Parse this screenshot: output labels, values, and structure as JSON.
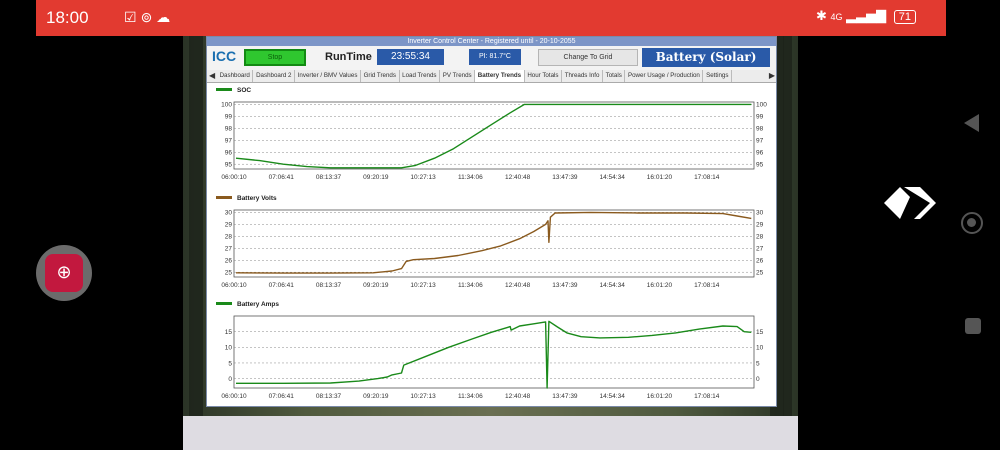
{
  "status_bar": {
    "time": "18:00",
    "network": "4G",
    "battery": "71"
  },
  "app": {
    "window_title": "Inverter Control Center - Registered until - 20-10-2055",
    "logo": "ICC",
    "stop_label": "Stop",
    "runtime_label": "RunTime",
    "runtime_value": "23:55:34",
    "pi_temp": "PI: 81.7°C",
    "grid_button": "Change To Grid",
    "battery_mode": "Battery (Solar)",
    "tabs": [
      "Dashboard",
      "Dashboard 2",
      "Inverter / BMV Values",
      "Grid Trends",
      "Load Trends",
      "PV Trends",
      "Battery Trends",
      "Hour Totals",
      "Threads Info",
      "Totals",
      "Power Usage / Production",
      "Settings"
    ],
    "active_tab": "Battery Trends"
  },
  "colors": {
    "status_bar": "#e23a30",
    "soc_line": "#1a8a1a",
    "volts_line": "#8a5a1e",
    "amps_line": "#1a8a1a",
    "button_blue": "#2a5aa8"
  },
  "chart_data": [
    {
      "type": "line",
      "title": "SOC",
      "x": [
        "06:00:10",
        "07:06:41",
        "08:13:37",
        "09:20:19",
        "10:27:13",
        "11:34:06",
        "12:40:48",
        "13:47:39",
        "14:54:34",
        "16:01:20",
        "17:08:14"
      ],
      "ylim": [
        94.6,
        100.2
      ],
      "yticks": [
        95,
        96,
        97,
        98,
        99,
        100
      ],
      "grid": true,
      "series": [
        {
          "name": "SOC",
          "points": [
            [
              0,
              95.5
            ],
            [
              0.5,
              95.3
            ],
            [
              1.0,
              95.0
            ],
            [
              1.5,
              94.8
            ],
            [
              2.0,
              94.7
            ],
            [
              2.5,
              94.7
            ],
            [
              3.0,
              94.7
            ],
            [
              3.5,
              94.7
            ],
            [
              3.8,
              94.9
            ],
            [
              4.2,
              95.5
            ],
            [
              4.6,
              96.3
            ],
            [
              5.0,
              97.3
            ],
            [
              5.4,
              98.3
            ],
            [
              5.8,
              99.3
            ],
            [
              6.1,
              100
            ],
            [
              7,
              100
            ],
            [
              8,
              100
            ],
            [
              9,
              100
            ],
            [
              10,
              100
            ],
            [
              10.9,
              100
            ]
          ]
        }
      ]
    },
    {
      "type": "line",
      "title": "Battery Volts",
      "x": [
        "06:00:10",
        "07:06:41",
        "08:13:37",
        "09:20:19",
        "10:27:13",
        "11:34:06",
        "12:40:48",
        "13:47:39",
        "14:54:34",
        "16:01:20",
        "17:08:14"
      ],
      "ylim": [
        24.6,
        30.2
      ],
      "yticks": [
        25,
        26,
        27,
        28,
        29,
        30
      ],
      "grid": true,
      "series": [
        {
          "name": "Battery Volts",
          "points": [
            [
              0,
              24.95
            ],
            [
              1,
              24.93
            ],
            [
              2,
              24.93
            ],
            [
              2.9,
              24.95
            ],
            [
              3.3,
              25.1
            ],
            [
              3.5,
              25.3
            ],
            [
              3.6,
              25.9
            ],
            [
              3.75,
              26.05
            ],
            [
              4.2,
              26.15
            ],
            [
              4.7,
              26.4
            ],
            [
              5.2,
              26.8
            ],
            [
              5.6,
              27.2
            ],
            [
              6.0,
              27.8
            ],
            [
              6.3,
              28.4
            ],
            [
              6.55,
              29.0
            ],
            [
              6.6,
              29.3
            ],
            [
              6.62,
              27.5
            ],
            [
              6.65,
              29.6
            ],
            [
              6.75,
              29.95
            ],
            [
              7.5,
              30.0
            ],
            [
              8.5,
              29.95
            ],
            [
              9.5,
              29.95
            ],
            [
              10.3,
              29.9
            ],
            [
              10.6,
              29.7
            ],
            [
              10.9,
              29.5
            ]
          ]
        }
      ]
    },
    {
      "type": "line",
      "title": "Battery Amps",
      "x": [
        "06:00:10",
        "07:06:41",
        "08:13:37",
        "09:20:19",
        "10:27:13",
        "11:34:06",
        "12:40:48",
        "13:47:39",
        "14:54:34",
        "16:01:20",
        "17:08:14"
      ],
      "ylim": [
        -3,
        20
      ],
      "yticks": [
        0,
        5,
        10,
        15
      ],
      "grid": true,
      "series": [
        {
          "name": "Battery Amps",
          "points": [
            [
              0,
              -1.5
            ],
            [
              1,
              -1.5
            ],
            [
              2,
              -1.4
            ],
            [
              2.6,
              -0.8
            ],
            [
              3.0,
              0.0
            ],
            [
              3.2,
              0.5
            ],
            [
              3.3,
              1.2
            ],
            [
              3.5,
              1.8
            ],
            [
              3.55,
              4.3
            ],
            [
              4.0,
              7.0
            ],
            [
              4.5,
              10.0
            ],
            [
              5.0,
              12.7
            ],
            [
              5.4,
              14.8
            ],
            [
              5.8,
              16.6
            ],
            [
              5.82,
              15.5
            ],
            [
              6.0,
              16.8
            ],
            [
              6.3,
              17.5
            ],
            [
              6.55,
              18.1
            ],
            [
              6.58,
              -3.0
            ],
            [
              6.62,
              18.3
            ],
            [
              6.8,
              16.5
            ],
            [
              7.0,
              14.6
            ],
            [
              7.3,
              13.4
            ],
            [
              7.7,
              13.0
            ],
            [
              8.3,
              13.2
            ],
            [
              8.8,
              13.8
            ],
            [
              9.3,
              14.6
            ],
            [
              9.8,
              15.8
            ],
            [
              10.3,
              16.8
            ],
            [
              10.6,
              16.6
            ],
            [
              10.75,
              15.0
            ],
            [
              10.9,
              14.8
            ]
          ]
        }
      ]
    }
  ]
}
